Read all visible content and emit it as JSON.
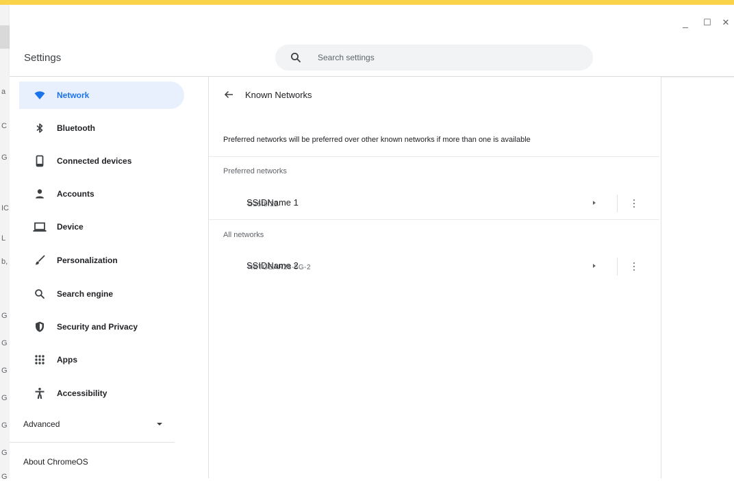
{
  "window": {
    "minimize_glyph": "_",
    "maximize_glyph": "☐",
    "close_glyph": "✕"
  },
  "left_strip_fragments": [
    "a",
    "C",
    "G",
    "IC",
    "L",
    "b,",
    "G",
    "G",
    "G",
    "G",
    "G",
    "G",
    "G"
  ],
  "header": {
    "app_title": "Settings",
    "search_placeholder": "Search settings",
    "search_icon": "search-icon"
  },
  "sidebar": {
    "items": [
      {
        "label": "Network",
        "icon": "wifi-icon",
        "active": true
      },
      {
        "label": "Bluetooth",
        "icon": "bluetooth-icon",
        "active": false
      },
      {
        "label": "Connected devices",
        "icon": "phone-icon",
        "active": false
      },
      {
        "label": "Accounts",
        "icon": "person-icon",
        "active": false
      },
      {
        "label": "Device",
        "icon": "laptop-icon",
        "active": false
      },
      {
        "label": "Personalization",
        "icon": "brush-icon",
        "active": false
      },
      {
        "label": "Search engine",
        "icon": "search-icon",
        "active": false
      },
      {
        "label": "Security and Privacy",
        "icon": "shield-icon",
        "active": false
      },
      {
        "label": "Apps",
        "icon": "apps-grid-icon",
        "active": false
      },
      {
        "label": "Accessibility",
        "icon": "accessibility-icon",
        "active": false
      }
    ],
    "advanced_label": "Advanced",
    "about_label": "About ChromeOS"
  },
  "main": {
    "back_icon": "back-arrow-icon",
    "page_title": "Known Networks",
    "description": "Preferred networks will be preferred over other known networks if more than one is available",
    "preferred_label": "Preferred networks",
    "all_label": "All networks",
    "preferred_networks": [
      {
        "name": "SSIDName 1",
        "underlying_text": "D25fbf22"
      }
    ],
    "all_networks": [
      {
        "name": "SSIDName 2",
        "underlying_text": "NETGEAR28-5G-2"
      }
    ]
  },
  "colors": {
    "accent": "#1a73e8",
    "active_bg": "#e8f0fe",
    "top_bar": "#fbd34a",
    "icon_gray": "#3c4043"
  }
}
